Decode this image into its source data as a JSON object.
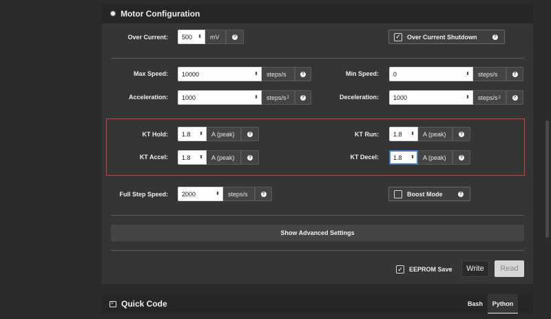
{
  "motor": {
    "title": "Motor Configuration",
    "icon": "gear-icon",
    "over_current": {
      "label": "Over Current:",
      "value": "500",
      "unit": "mV"
    },
    "over_current_shutdown": {
      "label": "Over Current Shutdown",
      "checked": true
    },
    "max_speed": {
      "label": "Max Speed:",
      "value": "10000",
      "unit": "steps/s"
    },
    "min_speed": {
      "label": "Min Speed:",
      "value": "0",
      "unit": "steps/s"
    },
    "acceleration": {
      "label": "Acceleration:",
      "value": "1000",
      "unit": "steps/s",
      "unit_sup": "2"
    },
    "deceleration": {
      "label": "Deceleration:",
      "value": "1000",
      "unit": "steps/s",
      "unit_sup": "2"
    },
    "kt_hold": {
      "label": "KT Hold:",
      "value": "1.8",
      "unit": "A (peak)"
    },
    "kt_run": {
      "label": "KT Run:",
      "value": "1.8",
      "unit": "A (peak)"
    },
    "kt_accel": {
      "label": "KT Accel:",
      "value": "1.8",
      "unit": "A (peak)"
    },
    "kt_decel": {
      "label": "KT Decel:",
      "value": "1.8",
      "unit": "A (peak)"
    },
    "full_step_speed": {
      "label": "Full Step Speed:",
      "value": "2000",
      "unit": "steps/s"
    },
    "boost_mode": {
      "label": "Boost Mode",
      "checked": false
    },
    "advanced_label": "Show Advanced Settings",
    "eeprom_save": {
      "label": "EEPROM Save",
      "checked": true
    },
    "write_label": "Write",
    "read_label": "Read"
  },
  "quick_code": {
    "title": "Quick Code",
    "tabs": [
      {
        "label": "Bash",
        "active": false
      },
      {
        "label": "Python",
        "active": true
      }
    ]
  },
  "colors": {
    "panel_bg": "#353535",
    "header_bg": "#262626",
    "highlight": "#d63a3a",
    "focus": "#4a7fd0"
  }
}
